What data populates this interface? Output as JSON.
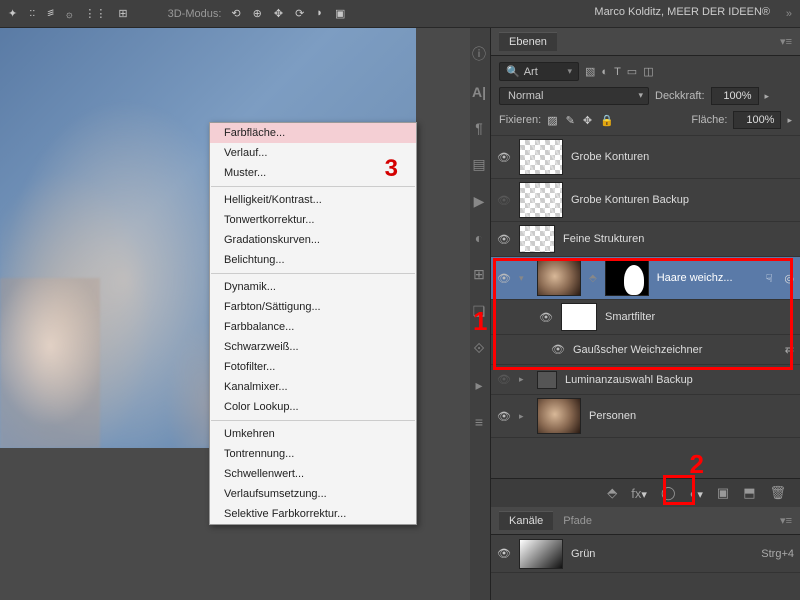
{
  "topbar": {
    "mode_label": "3D-Modus:",
    "credit": "Marco Kolditz, MEER DER IDEEN®"
  },
  "context_menu": {
    "items": [
      {
        "label": "Farbfläche...",
        "hl": true
      },
      {
        "label": "Verlauf..."
      },
      {
        "label": "Muster..."
      },
      {
        "sep": true
      },
      {
        "label": "Helligkeit/Kontrast..."
      },
      {
        "label": "Tonwertkorrektur..."
      },
      {
        "label": "Gradationskurven..."
      },
      {
        "label": "Belichtung..."
      },
      {
        "sep": true
      },
      {
        "label": "Dynamik..."
      },
      {
        "label": "Farbton/Sättigung..."
      },
      {
        "label": "Farbbalance..."
      },
      {
        "label": "Schwarzweiß..."
      },
      {
        "label": "Fotofilter..."
      },
      {
        "label": "Kanalmixer..."
      },
      {
        "label": "Color Lookup..."
      },
      {
        "sep": true
      },
      {
        "label": "Umkehren"
      },
      {
        "label": "Tontrennung..."
      },
      {
        "label": "Schwellenwert..."
      },
      {
        "label": "Verlaufsumsetzung..."
      },
      {
        "label": "Selektive Farbkorrektur..."
      }
    ],
    "annot": "3"
  },
  "layers_panel": {
    "title": "Ebenen",
    "search_label": "Art",
    "blend_mode": "Normal",
    "opacity_label": "Deckkraft:",
    "opacity_value": "100%",
    "fill_label": "Fläche:",
    "fill_value": "100%",
    "lock_label": "Fixieren:",
    "layers": {
      "l0": "Grobe Konturen",
      "l1": "Grobe Konturen Backup",
      "l2": "Feine Strukturen",
      "l3": "Haare weichz...",
      "l3a": "Smartfilter",
      "l3b": "Gaußscher Weichzeichner",
      "l4": "Luminanzauswahl Backup",
      "l5": "Personen"
    },
    "annot1": "1",
    "annot2": "2"
  },
  "channels_panel": {
    "tabs": [
      "Kanäle",
      "Pfade"
    ],
    "channel_name": "Grün",
    "channel_shortcut": "Strg+4"
  }
}
